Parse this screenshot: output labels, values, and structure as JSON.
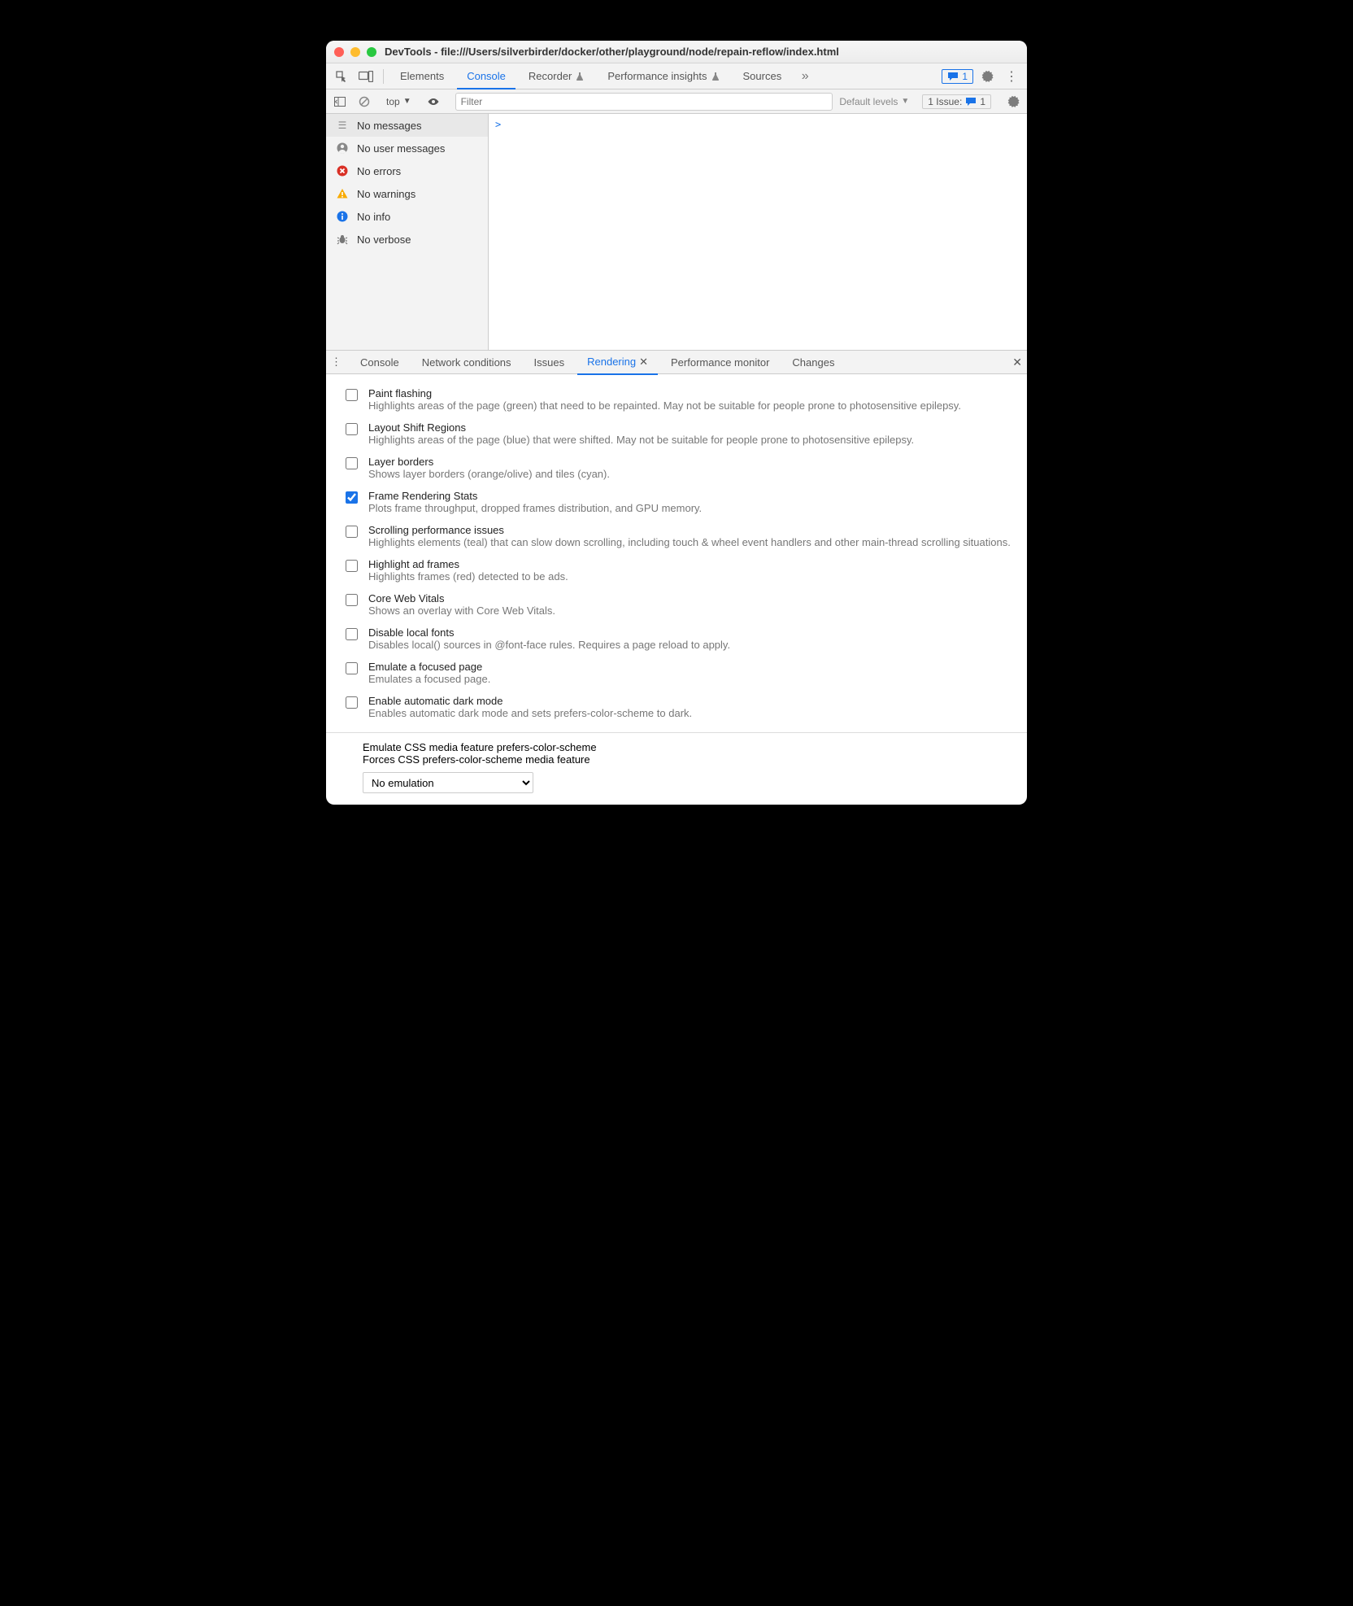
{
  "window": {
    "title": "DevTools - file:///Users/silverbirder/docker/other/playground/node/repain-reflow/index.html"
  },
  "mainTabs": {
    "elements": "Elements",
    "console": "Console",
    "recorder": "Recorder",
    "perfInsights": "Performance insights",
    "sources": "Sources",
    "messagesCount": "1"
  },
  "consoleToolbar": {
    "context": "top",
    "filterPlaceholder": "Filter",
    "levels": "Default levels",
    "issuesLabel": "1 Issue:",
    "issuesCount": "1"
  },
  "sidebar": {
    "noMessages": "No messages",
    "noUserMessages": "No user messages",
    "noErrors": "No errors",
    "noWarnings": "No warnings",
    "noInfo": "No info",
    "noVerbose": "No verbose"
  },
  "consolePrompt": ">",
  "drawerTabs": {
    "console": "Console",
    "network": "Network conditions",
    "issues": "Issues",
    "rendering": "Rendering",
    "perfmon": "Performance monitor",
    "changes": "Changes"
  },
  "rendering": {
    "paintFlashing": {
      "t": "Paint flashing",
      "d": "Highlights areas of the page (green) that need to be repainted. May not be suitable for people prone to photosensitive epilepsy."
    },
    "layoutShift": {
      "t": "Layout Shift Regions",
      "d": "Highlights areas of the page (blue) that were shifted. May not be suitable for people prone to photosensitive epilepsy."
    },
    "layerBorders": {
      "t": "Layer borders",
      "d": "Shows layer borders (orange/olive) and tiles (cyan)."
    },
    "frameStats": {
      "t": "Frame Rendering Stats",
      "d": "Plots frame throughput, dropped frames distribution, and GPU memory."
    },
    "scrollPerf": {
      "t": "Scrolling performance issues",
      "d": "Highlights elements (teal) that can slow down scrolling, including touch & wheel event handlers and other main-thread scrolling situations."
    },
    "adFrames": {
      "t": "Highlight ad frames",
      "d": "Highlights frames (red) detected to be ads."
    },
    "cwv": {
      "t": "Core Web Vitals",
      "d": "Shows an overlay with Core Web Vitals."
    },
    "localFonts": {
      "t": "Disable local fonts",
      "d": "Disables local() sources in @font-face rules. Requires a page reload to apply."
    },
    "focusedPage": {
      "t": "Emulate a focused page",
      "d": "Emulates a focused page."
    },
    "darkMode": {
      "t": "Enable automatic dark mode",
      "d": "Enables automatic dark mode and sets prefers-color-scheme to dark."
    },
    "colorScheme": {
      "t": "Emulate CSS media feature prefers-color-scheme",
      "d": "Forces CSS prefers-color-scheme media feature",
      "v": "No emulation"
    }
  }
}
